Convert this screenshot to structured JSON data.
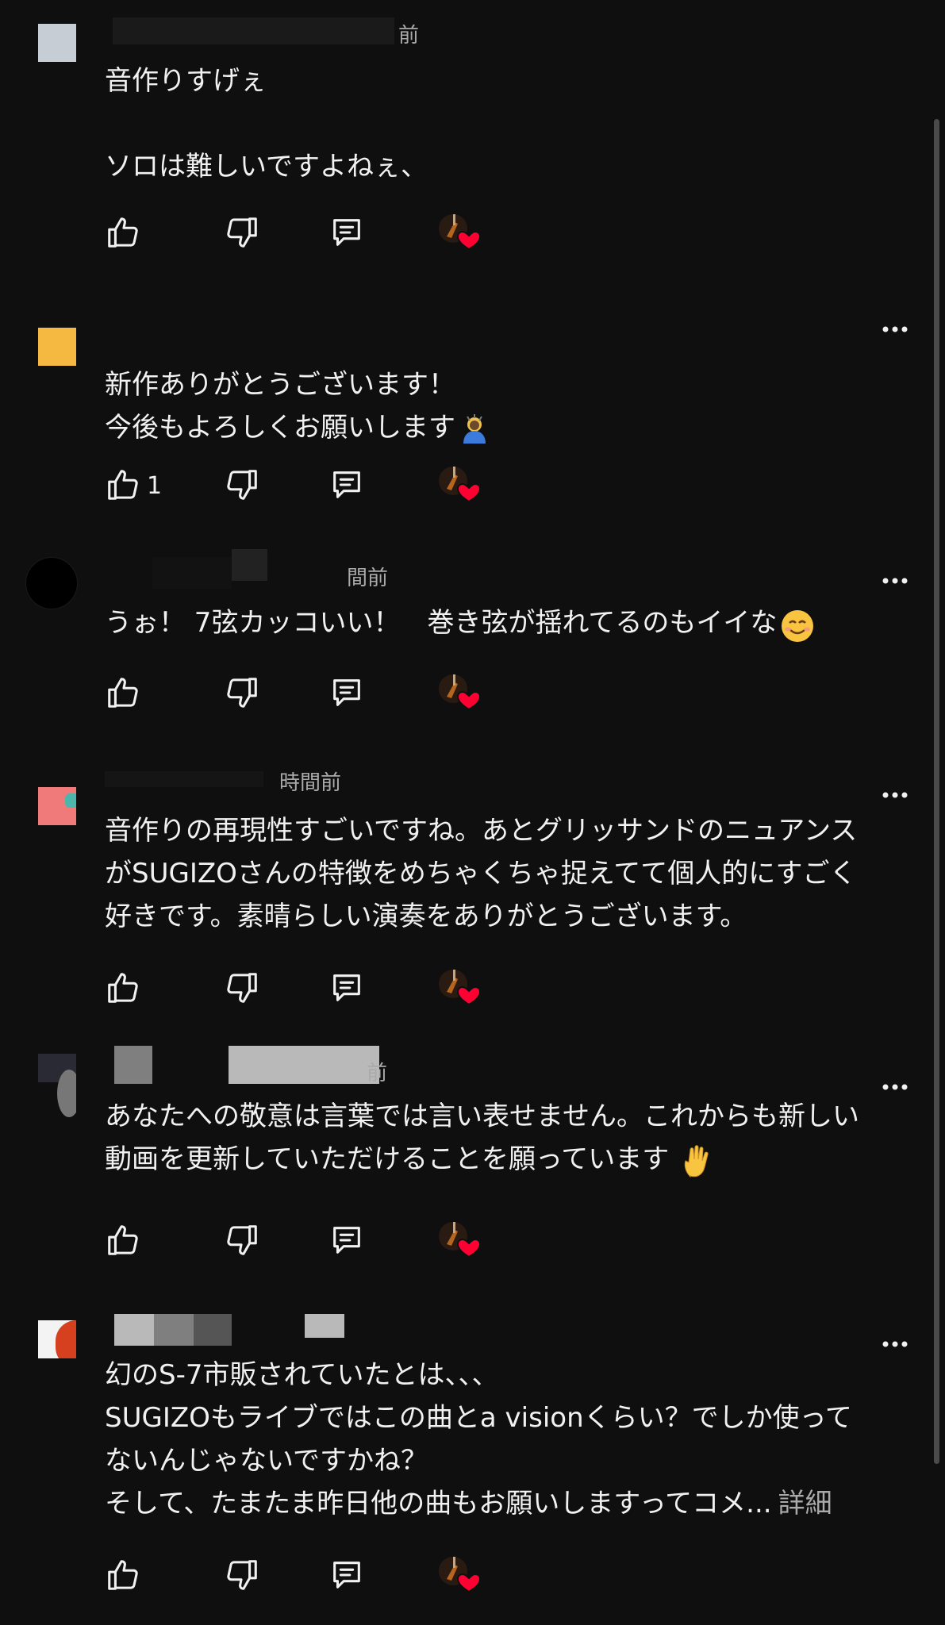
{
  "comments": [
    {
      "time": "前",
      "body": "音作りすげぇ\n\nソロは難しいですよねぇ、",
      "likes": "",
      "avatar_color": "#c7cdd4",
      "has_menu": false
    },
    {
      "time": "",
      "body": "新作ありがとうございます！\n今後もよろしくお願いします",
      "likes": "1",
      "avatar_color": "#f5b942",
      "has_menu": true,
      "trailing_emoji": "bowing-person-emoji"
    },
    {
      "time": "間前",
      "body": "うぉ！ 7弦カッコいい！　巻き弦が揺れてるのもイイな",
      "likes": "",
      "avatar_color": "#000000",
      "has_menu": true,
      "trailing_emoji": "smiling-face-emoji"
    },
    {
      "time": "時間前",
      "body": "音作りの再現性すごいですね。あとグリッサンドのニュアンスがSUGIZOさんの特徴をめちゃくちゃ捉えてて個人的にすごく好きです。素晴らしい演奏をありがとうございます。",
      "likes": "",
      "avatar_color": "#f07a7a",
      "has_menu": true
    },
    {
      "time": "前",
      "body": "あなたへの敬意は言葉では言い表せません。これからも新しい動画を更新していただけることを願っています ",
      "likes": "",
      "avatar_color": "#2a2a35",
      "has_menu": true,
      "trailing_emoji": "raised-hand-emoji"
    },
    {
      "time": "",
      "body": "幻のS-7市販されていたとは、、、\nSUGIZOもライブではこの曲とa visionくらい？でしか使ってないんじゃないですかね？\nそして、たまたま昨日他の曲もお願いしますってコメ...",
      "more": "詳細",
      "likes": "",
      "avatar_color": "#f3f3f3",
      "has_menu": true
    }
  ],
  "icons": {
    "like": "thumbs-up-icon",
    "dislike": "thumbs-down-icon",
    "reply": "reply-icon",
    "creator_heart": "creator-heart-icon",
    "menu": "more-vert-icon"
  },
  "colors": {
    "background": "#0f0f0f",
    "text": "#f1f1f1",
    "secondary_text": "#aaaaaa",
    "heart": "#ff0033"
  }
}
